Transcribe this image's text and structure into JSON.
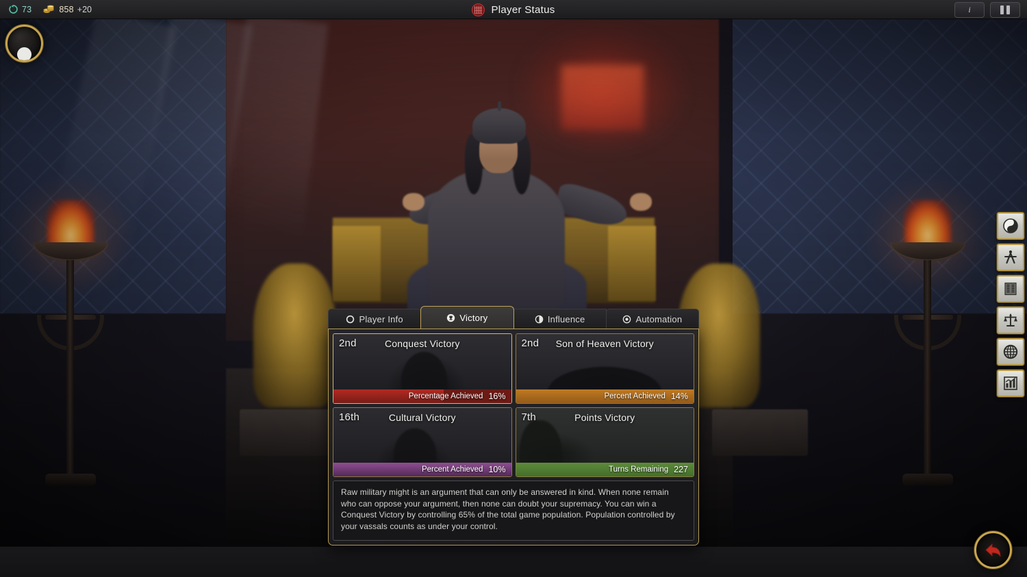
{
  "topbar": {
    "resources": [
      {
        "name": "influence",
        "icon": "influence-icon",
        "value": "73",
        "delta": ""
      },
      {
        "name": "money",
        "icon": "money-icon",
        "value": "858",
        "delta": "+20"
      }
    ],
    "title": "Player Status",
    "title_icon": "imperial-seal-icon",
    "buttons": [
      {
        "name": "info-button",
        "icon": "info-icon",
        "label": "i"
      },
      {
        "name": "pause-button",
        "icon": "pause-icon",
        "label": ""
      }
    ]
  },
  "avatar": {
    "name": "player-avatar",
    "icon": "player-portrait-icon"
  },
  "sidebar": {
    "items": [
      {
        "name": "sidebar-item-religion",
        "icon": "yin-yang-icon"
      },
      {
        "name": "sidebar-item-science",
        "icon": "compass-divider-icon"
      },
      {
        "name": "sidebar-item-civics",
        "icon": "scroll-text-icon"
      },
      {
        "name": "sidebar-item-diplomacy",
        "icon": "scales-of-justice-icon"
      },
      {
        "name": "sidebar-item-empire",
        "icon": "globe-seal-icon"
      },
      {
        "name": "sidebar-item-statistics",
        "icon": "bar-chart-icon"
      }
    ]
  },
  "back_button": {
    "name": "back-button",
    "icon": "back-arrow-icon",
    "color": "#c0281f"
  },
  "panel": {
    "tabs": [
      {
        "label": "Player Info",
        "icon": "circle-outline-icon",
        "active": false
      },
      {
        "label": "Victory",
        "icon": "trophy-icon",
        "active": true
      },
      {
        "label": "Influence",
        "icon": "half-circle-icon",
        "active": false
      },
      {
        "label": "Automation",
        "icon": "target-dot-icon",
        "active": false
      }
    ],
    "victories": [
      {
        "id": "conquest",
        "rank": "2nd",
        "title": "Conquest Victory",
        "metric_label": "Percentage Achieved",
        "metric_value": "16%",
        "bar_fill_percent": 62,
        "bar_color": "#b22a22",
        "bar_color_dark": "#6d1a15",
        "selected": true
      },
      {
        "id": "son-of-heaven",
        "rank": "2nd",
        "title": "Son of Heaven Victory",
        "metric_label": "Percent Achieved",
        "metric_value": "14%",
        "bar_fill_percent": 100,
        "bar_color": "#c07a22",
        "bar_color_dark": "#8d5618",
        "selected": false
      },
      {
        "id": "cultural",
        "rank": "16th",
        "title": "Cultural Victory",
        "metric_label": "Percent Achieved",
        "metric_value": "10%",
        "bar_fill_percent": 100,
        "bar_color": "#8e4e91",
        "bar_color_dark": "#4a2450",
        "selected": false
      },
      {
        "id": "points",
        "rank": "7th",
        "title": "Points Victory",
        "metric_label": "Turns Remaining",
        "metric_value": "227",
        "bar_fill_percent": 100,
        "bar_color": "#5d8b3a",
        "bar_color_dark": "#3f6b28",
        "selected": false
      }
    ],
    "description": "Raw military might is an argument that can only be answered in kind. When none remain who can oppose your argument, then none can doubt your supremacy. You can win a Conquest Victory by controlling 65% of the total game population. Population controlled by your vassals counts as under your control."
  }
}
